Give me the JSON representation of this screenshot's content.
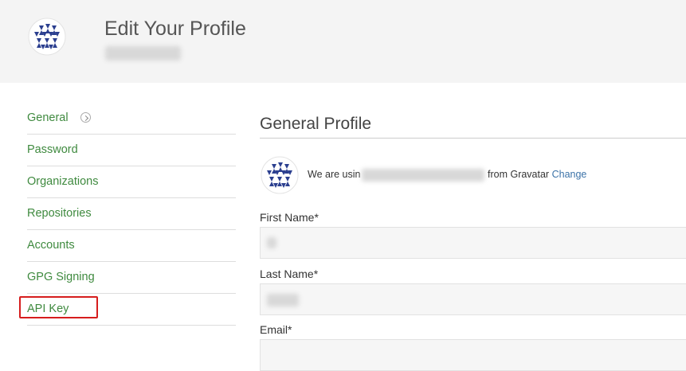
{
  "header": {
    "title": "Edit Your Profile",
    "avatar_icon": "logo-avatar-icon"
  },
  "sidebar": {
    "items": [
      {
        "label": "General",
        "active": true
      },
      {
        "label": "Password"
      },
      {
        "label": "Organizations"
      },
      {
        "label": "Repositories"
      },
      {
        "label": "Accounts"
      },
      {
        "label": "GPG Signing"
      },
      {
        "label": "API Key",
        "highlighted": true
      }
    ]
  },
  "main": {
    "title": "General Profile",
    "gravatar": {
      "prefix": "We are usin",
      "from": "from Gravatar",
      "change_link": "Change"
    },
    "fields": {
      "first_name_label": "First Name*",
      "last_name_label": "Last Name*",
      "email_label": "Email*"
    }
  },
  "colors": {
    "header_bg": "#f4f4f4",
    "nav_link": "#3f8a3f",
    "highlight_border": "#d61d1d",
    "link": "#3c73a8"
  }
}
